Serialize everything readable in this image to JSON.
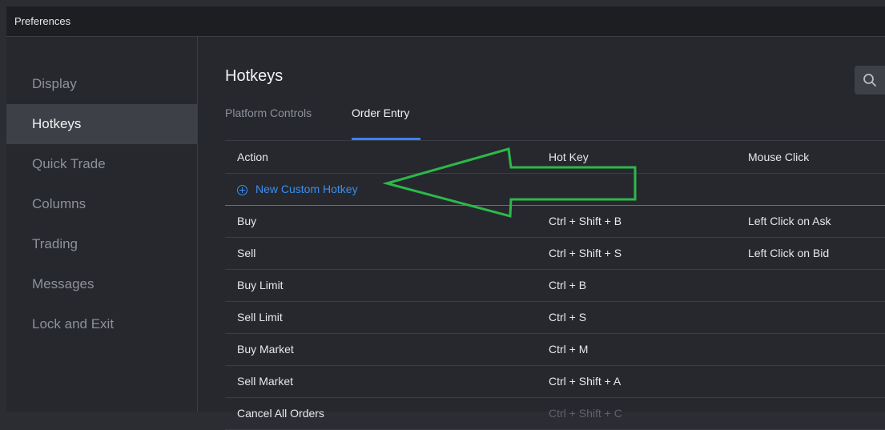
{
  "window": {
    "title": "Preferences"
  },
  "sidebar": {
    "items": [
      {
        "label": "Display",
        "active": false
      },
      {
        "label": "Hotkeys",
        "active": true
      },
      {
        "label": "Quick Trade",
        "active": false
      },
      {
        "label": "Columns",
        "active": false
      },
      {
        "label": "Trading",
        "active": false
      },
      {
        "label": "Messages",
        "active": false
      },
      {
        "label": "Lock and Exit",
        "active": false
      }
    ]
  },
  "main": {
    "title": "Hotkeys",
    "search_icon": "search-icon",
    "tabs": [
      {
        "label": "Platform Controls",
        "active": false
      },
      {
        "label": "Order Entry",
        "active": true
      }
    ],
    "table": {
      "columns": [
        "Action",
        "Hot Key",
        "Mouse Click"
      ],
      "new_hotkey_label": "New Custom Hotkey",
      "rows": [
        {
          "action": "Buy",
          "hotkey": "Ctrl + Shift + B",
          "mouse": "Left Click on Ask"
        },
        {
          "action": "Sell",
          "hotkey": "Ctrl + Shift + S",
          "mouse": "Left Click on Bid"
        },
        {
          "action": "Buy Limit",
          "hotkey": "Ctrl + B",
          "mouse": ""
        },
        {
          "action": "Sell Limit",
          "hotkey": "Ctrl + S",
          "mouse": ""
        },
        {
          "action": "Buy Market",
          "hotkey": "Ctrl + M",
          "mouse": ""
        },
        {
          "action": "Sell Market",
          "hotkey": "Ctrl + Shift + A",
          "mouse": ""
        },
        {
          "action": "Cancel All Orders",
          "hotkey": "Ctrl + Shift + C",
          "mouse": ""
        }
      ]
    }
  },
  "annotation": {
    "arrow_color": "#2db84a"
  },
  "colors": {
    "accent": "#3b82f6",
    "link": "#3b8ff0",
    "background": "#26282e"
  }
}
